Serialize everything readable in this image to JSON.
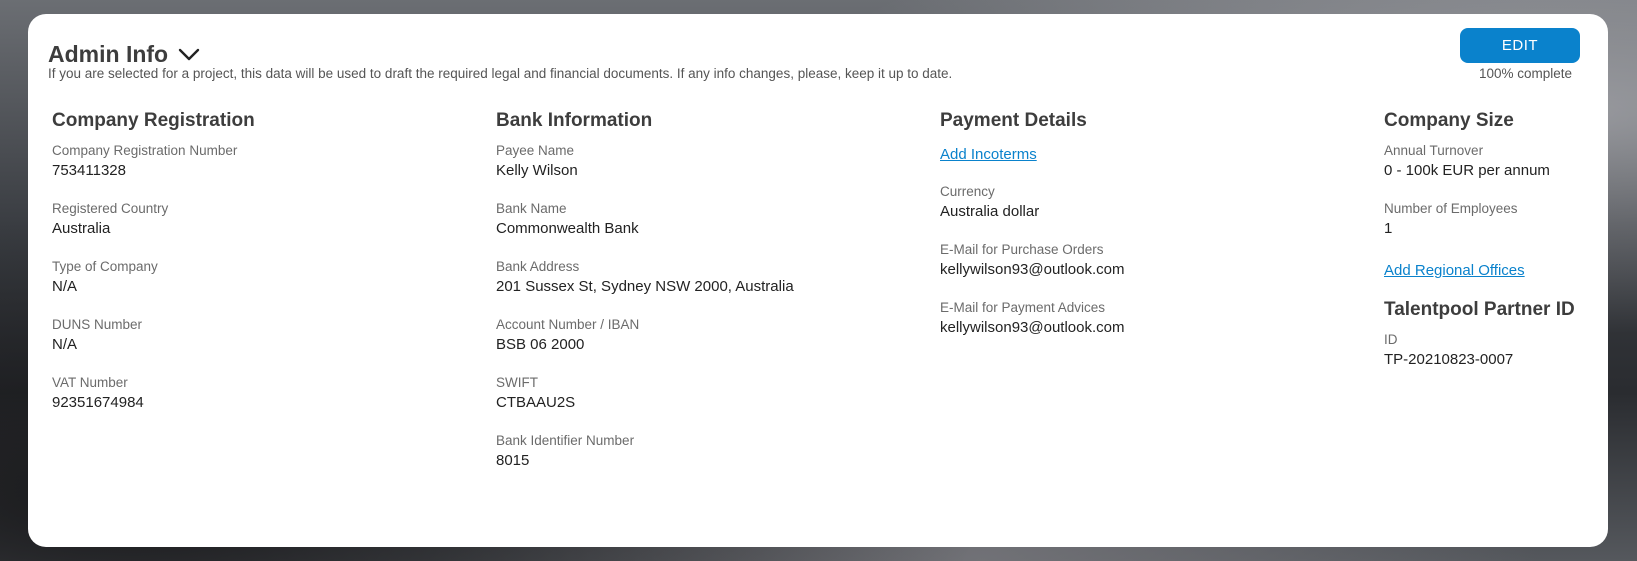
{
  "header": {
    "title": "Admin Info",
    "subtitle": "If you are selected for a project, this data will be used to draft the required legal and financial documents. If any info changes, please, keep it up to date.",
    "edit_label": "EDIT",
    "completion": "100% complete"
  },
  "company_registration": {
    "heading": "Company Registration",
    "fields": [
      {
        "label": "Company Registration Number",
        "value": "753411328"
      },
      {
        "label": "Registered Country",
        "value": "Australia"
      },
      {
        "label": "Type of Company",
        "value": "N/A"
      },
      {
        "label": "DUNS Number",
        "value": "N/A"
      },
      {
        "label": "VAT Number",
        "value": "92351674984"
      }
    ]
  },
  "bank_information": {
    "heading": "Bank Information",
    "fields": [
      {
        "label": "Payee Name",
        "value": "Kelly Wilson"
      },
      {
        "label": "Bank Name",
        "value": "Commonwealth Bank"
      },
      {
        "label": "Bank Address",
        "value": "201 Sussex St, Sydney NSW 2000, Australia"
      },
      {
        "label": "Account Number / IBAN",
        "value": "BSB 06 2000"
      },
      {
        "label": "SWIFT",
        "value": "CTBAAU2S"
      },
      {
        "label": "Bank Identifier Number",
        "value": "8015"
      }
    ]
  },
  "payment_details": {
    "heading": "Payment Details",
    "add_incoterms_label": "Add Incoterms",
    "fields": [
      {
        "label": "Currency",
        "value": "Australia dollar"
      },
      {
        "label": "E-Mail for Purchase Orders",
        "value": "kellywilson93@outlook.com"
      },
      {
        "label": "E-Mail for Payment Advices",
        "value": "kellywilson93@outlook.com"
      }
    ]
  },
  "company_size": {
    "heading": "Company Size",
    "fields": [
      {
        "label": "Annual Turnover",
        "value": "0 - 100k EUR per annum"
      },
      {
        "label": "Number of Employees",
        "value": "1"
      }
    ],
    "add_regional_offices_label": "Add Regional Offices"
  },
  "talentpool": {
    "heading": "Talentpool Partner ID",
    "fields": [
      {
        "label": "ID",
        "value": "TP-20210823-0007"
      }
    ]
  },
  "colors": {
    "accent": "#0a82cc",
    "heading": "#3d3d3d",
    "label": "#6b6b6b"
  },
  "icons": {
    "expand": "chevron-down-icon"
  }
}
